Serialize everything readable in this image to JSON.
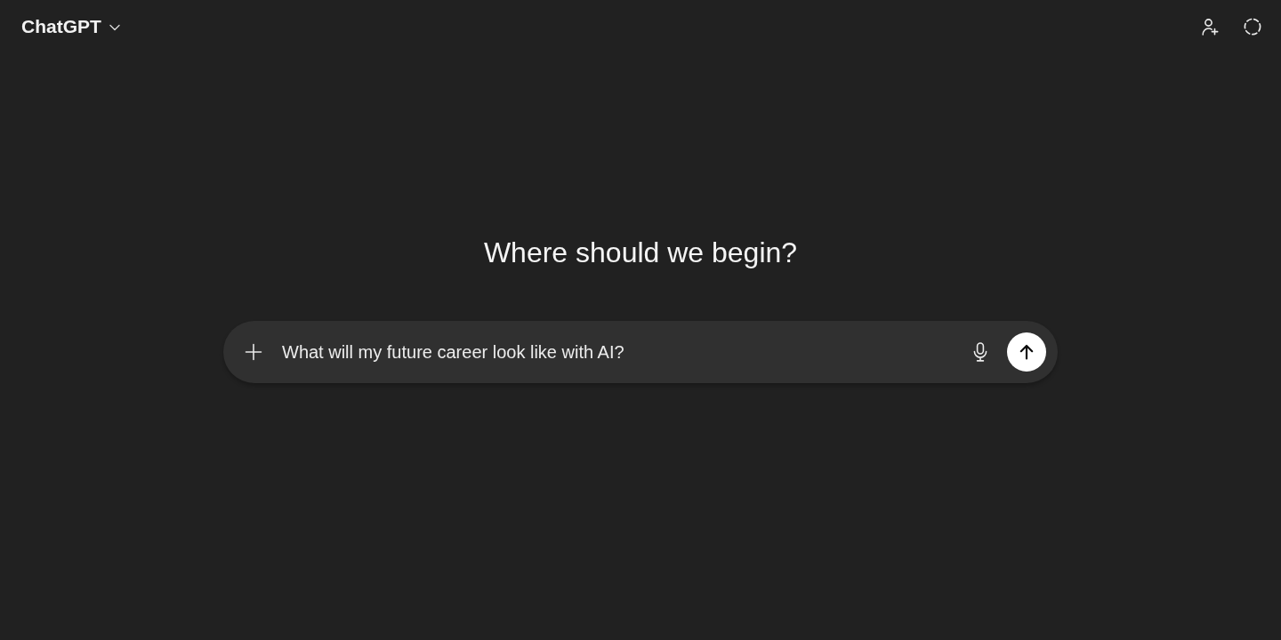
{
  "header": {
    "title": "ChatGPT"
  },
  "heading": "Where should we begin?",
  "composer": {
    "value": "What will my future career look like with AI?"
  }
}
